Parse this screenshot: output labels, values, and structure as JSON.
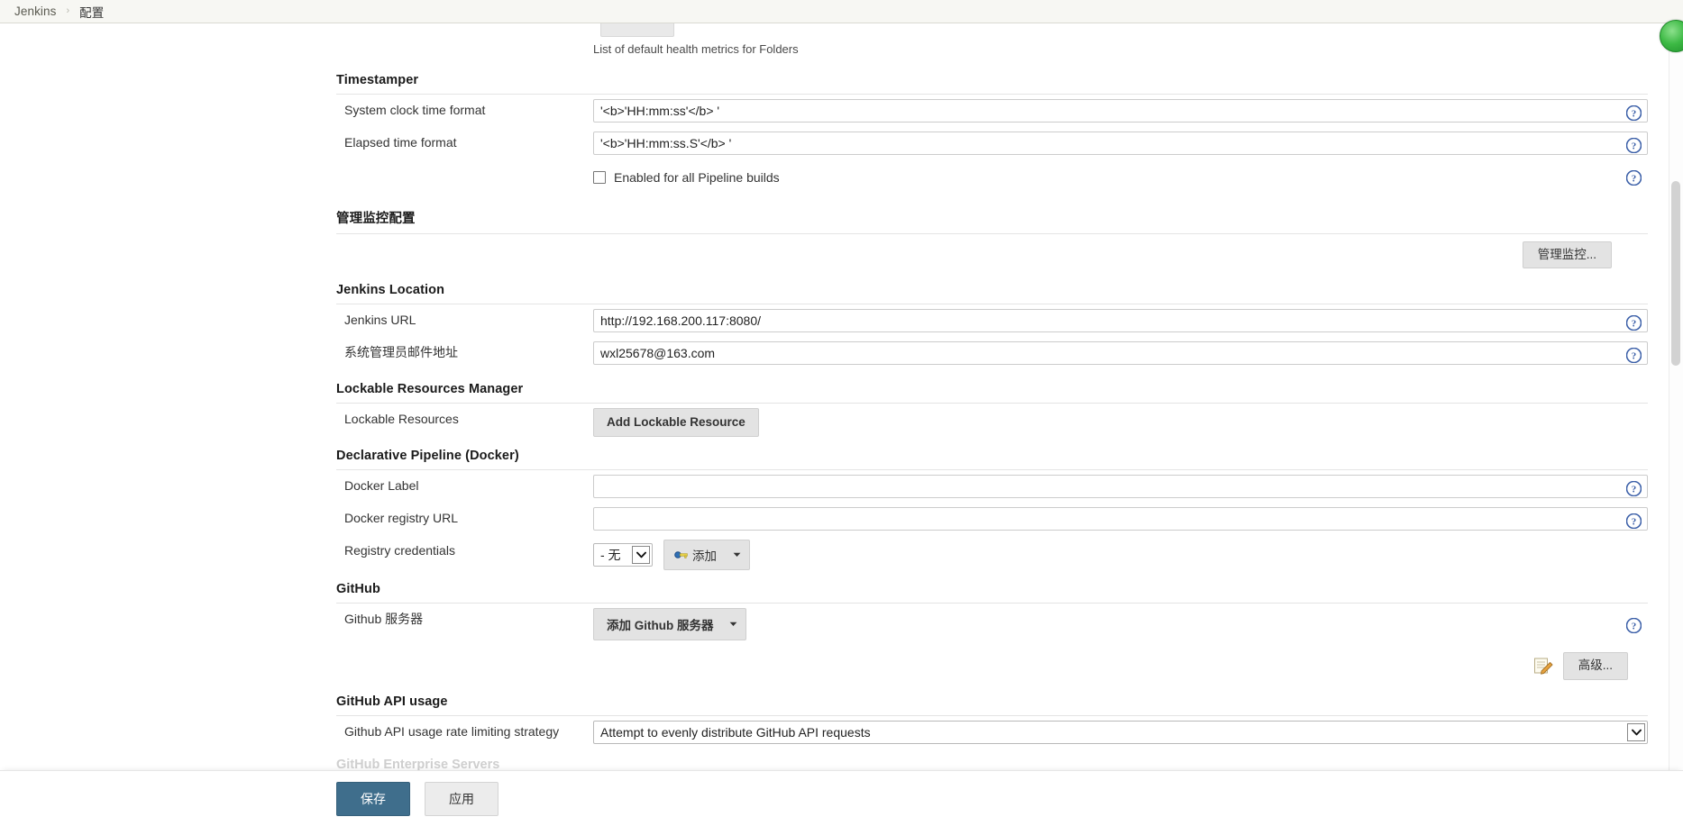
{
  "breadcrumb": {
    "items": [
      {
        "label": "Jenkins",
        "current": false
      },
      {
        "label": "配置",
        "current": true
      }
    ],
    "separator": "›"
  },
  "top_partial": {
    "health_metrics_hint": "List of default health metrics for Folders"
  },
  "sections": {
    "timestamper": {
      "title": "Timestamper",
      "system_clock_label": "System clock time format",
      "system_clock_value": "'<b>'HH:mm:ss'</b> '",
      "elapsed_label": "Elapsed time format",
      "elapsed_value": "'<b>'HH:mm:ss.S'</b> '",
      "pipeline_checkbox_label": "Enabled for all Pipeline builds",
      "pipeline_checkbox_checked": false
    },
    "monitoring": {
      "title": "管理监控配置",
      "manage_button": "管理监控..."
    },
    "jenkins_location": {
      "title": "Jenkins Location",
      "url_label": "Jenkins URL",
      "url_value": "http://192.168.200.117:8080/",
      "admin_email_label": "系统管理员邮件地址",
      "admin_email_value": "wxl25678@163.com"
    },
    "lockable_resources": {
      "title": "Lockable Resources Manager",
      "label": "Lockable Resources",
      "add_button": "Add Lockable Resource"
    },
    "declarative_docker": {
      "title": "Declarative Pipeline (Docker)",
      "docker_label_label": "Docker Label",
      "docker_label_value": "",
      "docker_registry_label": "Docker registry URL",
      "docker_registry_value": "",
      "registry_credentials_label": "Registry credentials",
      "registry_credentials_value": "- 无 -",
      "registry_credentials_options": [
        "- 无 -"
      ],
      "add_credentials_button": "添加"
    },
    "github": {
      "title": "GitHub",
      "server_label": "Github 服务器",
      "add_server_button": "添加 Github 服务器",
      "advanced_button": "高级..."
    },
    "github_api_usage": {
      "title": "GitHub API usage",
      "strategy_label": "Github API usage rate limiting strategy",
      "strategy_value": "Attempt to evenly distribute GitHub API requests",
      "strategy_options": [
        "Attempt to evenly distribute GitHub API requests"
      ]
    },
    "github_enterprise": {
      "title": "GitHub Enterprise Servers"
    }
  },
  "footer": {
    "save_label": "保存",
    "apply_label": "应用"
  },
  "icons": {
    "help": "help-icon",
    "notebook": "notebook-pencil-icon",
    "caret": "chevron-down-icon",
    "key": "key-icon",
    "status": "green-status-indicator"
  },
  "colors": {
    "save_button": "#3f6e8c",
    "help_icon": "#3b5fa8",
    "status_green": "#3cb944",
    "breadcrumb_bg": "#f7f7f3",
    "page_bg": "#ffffff"
  }
}
